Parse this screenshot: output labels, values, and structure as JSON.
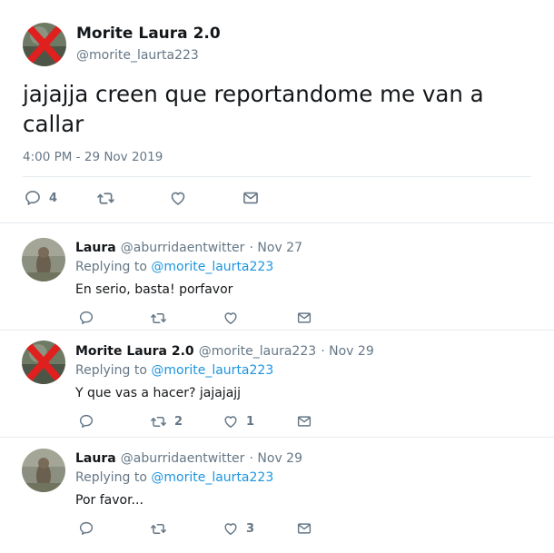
{
  "main_tweet": {
    "author_name": "Morite Laura 2.0",
    "handle": "@morite_laurta223",
    "text": "jajajja creen que reportandome me van a callar",
    "timestamp": "4:00 PM - 29 Nov 2019",
    "reply_count": "4",
    "retweet_count": "",
    "like_count": ""
  },
  "replies": [
    {
      "author_name": "Laura",
      "handle": "@aburridaentwitter",
      "date": "· Nov 27",
      "replying_to_label": "Replying to",
      "replying_to_handle": "@morite_laurta223",
      "text": "En serio, basta! porfavor",
      "reply_count": "",
      "retweet_count": "",
      "like_count": ""
    },
    {
      "author_name": "Morite Laura 2.0",
      "handle": "@morite_laura223",
      "date": "· Nov 29",
      "replying_to_label": "Replying to",
      "replying_to_handle": "@morite_laurta223",
      "text": "Y que vas a hacer? jajajajj",
      "reply_count": "",
      "retweet_count": "2",
      "like_count": "1"
    },
    {
      "author_name": "Laura",
      "handle": "@aburridaentwitter",
      "date": "· Nov 29",
      "replying_to_label": "Replying to",
      "replying_to_handle": "@morite_laurta223",
      "text": "Por favor...",
      "reply_count": "",
      "retweet_count": "",
      "like_count": "3"
    }
  ],
  "colors": {
    "link": "#1b95e0",
    "secondary_text": "#657786",
    "primary_text": "#14171a",
    "divider": "#e6ecf0"
  },
  "icons": {
    "reply": "reply-icon",
    "retweet": "retweet-icon",
    "like": "heart-icon",
    "message": "envelope-icon"
  }
}
